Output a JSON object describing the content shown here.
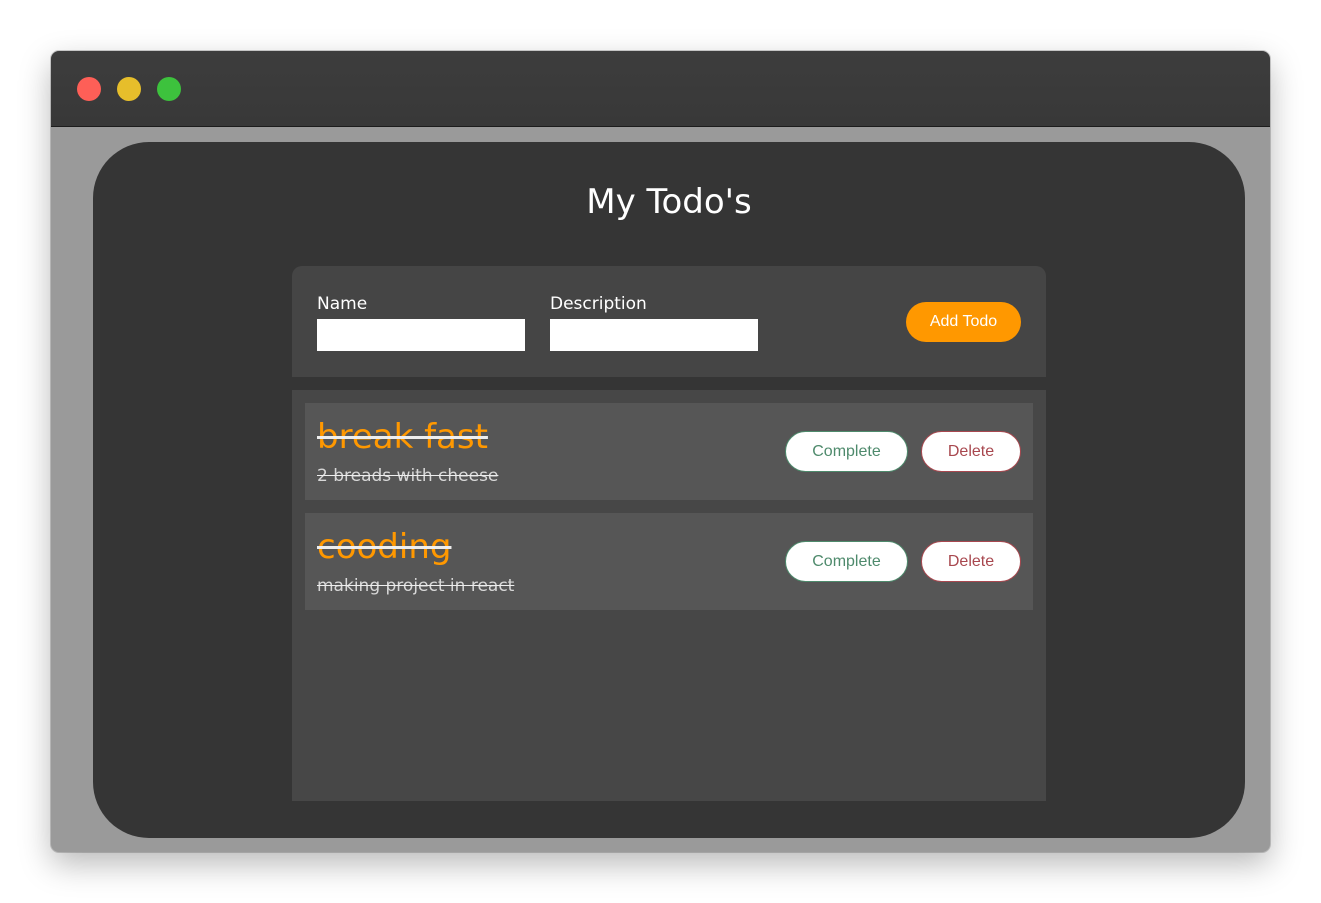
{
  "window": {
    "controls": [
      "close",
      "minimize",
      "maximize"
    ]
  },
  "app": {
    "title": "My Todo's"
  },
  "form": {
    "name_label": "Name",
    "name_value": "",
    "description_label": "Description",
    "description_value": "",
    "add_button_label": "Add Todo"
  },
  "todos": [
    {
      "name": "break fast",
      "description": "2 breads with cheese",
      "completed": true,
      "complete_label": "Complete",
      "delete_label": "Delete"
    },
    {
      "name": "cooding",
      "description": "making project in react",
      "completed": true,
      "complete_label": "Complete",
      "delete_label": "Delete"
    }
  ],
  "colors": {
    "accent": "#ff9800",
    "complete": "#4e8a6c",
    "delete": "#a8484f",
    "close_dot": "#fe5f57",
    "minimize_dot": "#e6be2b",
    "maximize_dot": "#3dc23d"
  }
}
